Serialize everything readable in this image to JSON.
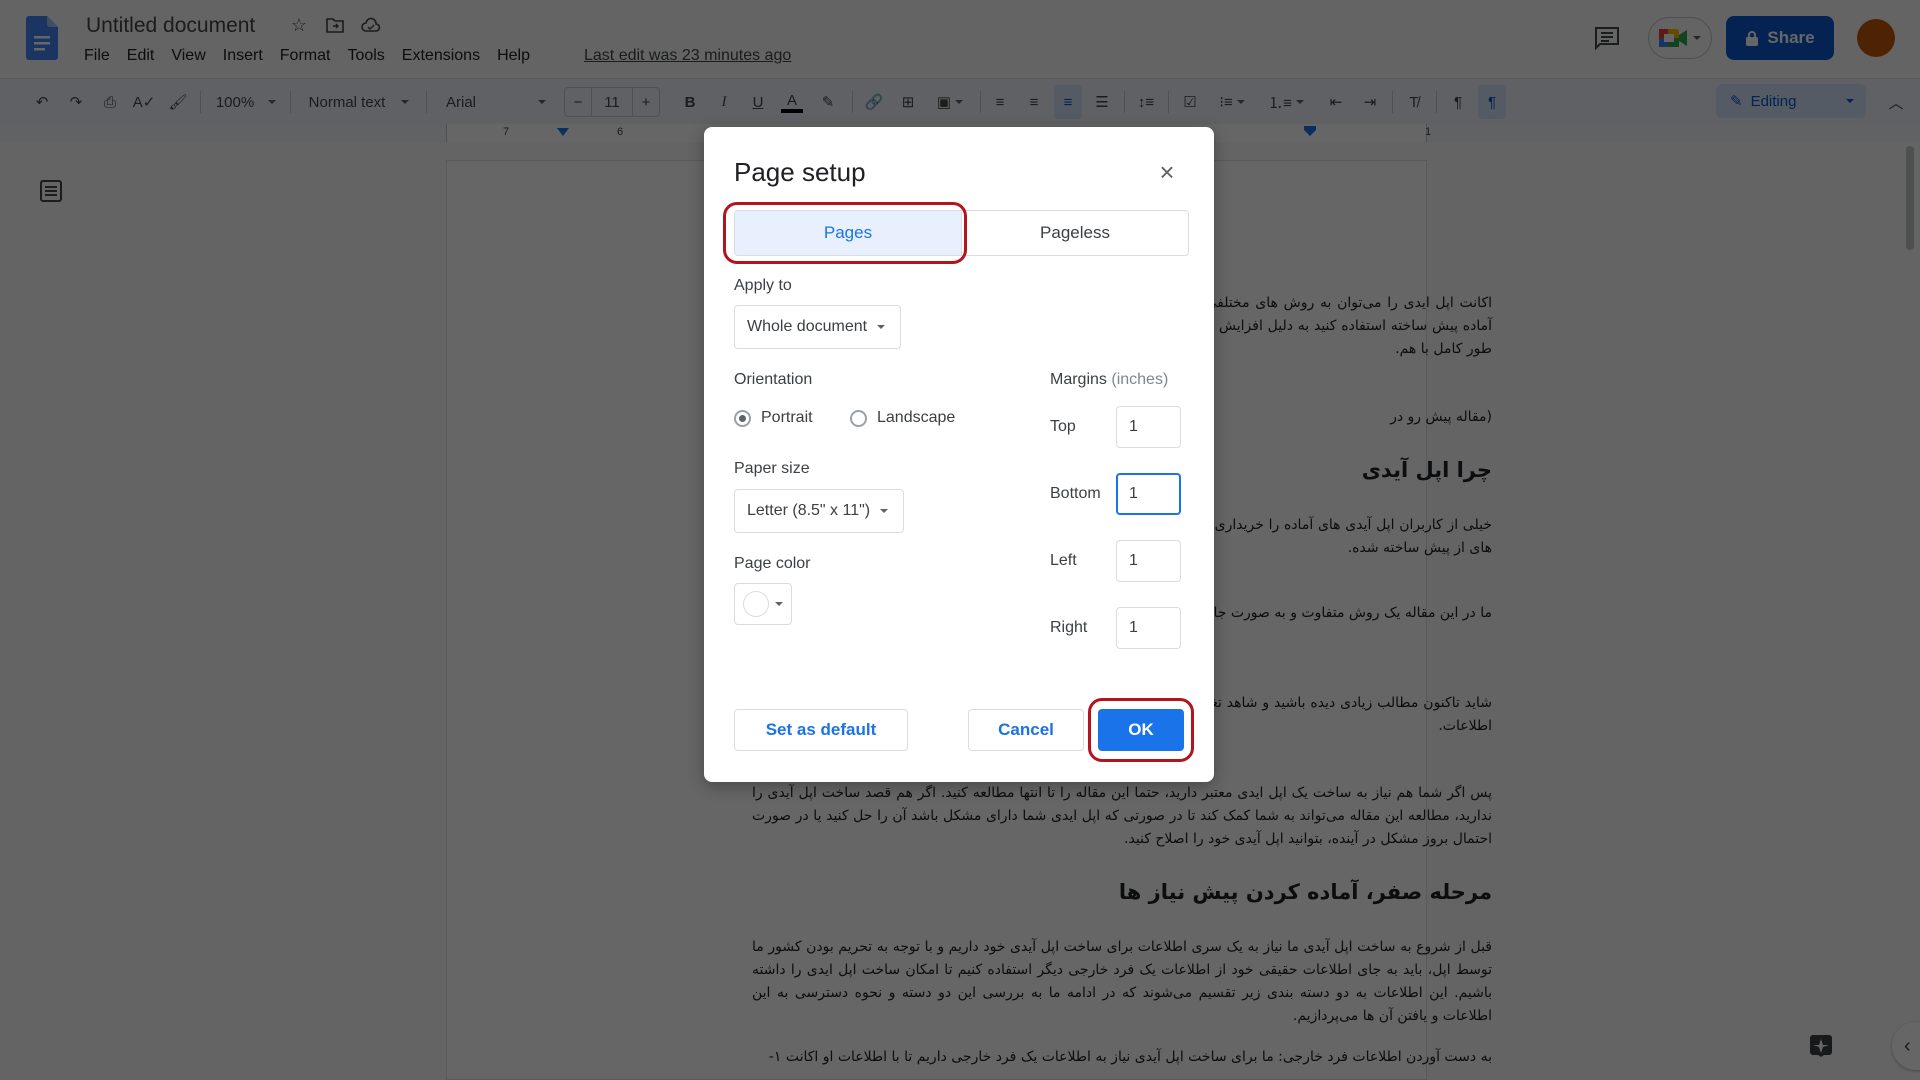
{
  "app": {
    "title": "Untitled document",
    "menu": [
      "File",
      "Edit",
      "View",
      "Insert",
      "Format",
      "Tools",
      "Extensions",
      "Help"
    ],
    "last_edit": "Last edit was 23 minutes ago",
    "share_label": "Share",
    "accent": "#0b57d0",
    "avatar_color": "#c2580a"
  },
  "toolbar": {
    "zoom": "100%",
    "style": "Normal text",
    "font": "Arial",
    "font_size": "11",
    "mode": "Editing",
    "ruler_labels": [
      "7",
      "6",
      "1"
    ]
  },
  "document": {
    "paragraphs": [
      "اکانت اپل ایدی را می‌توان به روش های مختلفی ساخت. در این مقاله نحوه ساخت این اکانت است. چرا که از اپل آیدی های آماده پیش ساخته استفاده کنید به دلیل افزایش تحریم ها علیه ایران بیشتر کاربران ایرانی ممکن است مشکلات امنیتی اپل را به طور کامل با هم.",
      "(مقاله پیش رو در",
      "خیلی از کاربران اپل آیدی های آماده را خریداری میکنند که اصلا توصیه نمی‌شود. مخاطراتی مانند قطع دسترسی اپل به اپل آیدی های از پیش ساخته شده.",
      "ما در این مقاله یک روش متفاوت و به صورت جامع برای ساخت با شماره تلفن مجازی اکانت اپل ایدی.",
      "شاید تاکنون مطالب زیادی دیده باشید و شاهد تغییر جزئی و گاها تغییر کلی در نحوه ساخت بودید. ما تست کردیم و سعی کردیم اطلاعات.",
      "پس اگر شما هم نیاز به ساخت یک اپل ایدی معتبر دارید، حتما این مقاله را تا انتها مطالعه کنید. اگر هم قصد ساخت اپل آیدی را ندارید، مطالعه این مقاله می‌تواند به شما کمک کند تا در صورتی که اپل ایدی شما دارای مشکل باشد آن را حل کنید یا در صورت احتمال بروز مشکل در آینده، بتوانید اپل آیدی خود را اصلاح کنید.",
      "قبل از شروع به ساخت اپل آیدی ما نیاز به یک سری اطلاعات برای ساخت اپل آیدی خود داریم و با توجه به تحریم بودن کشور ما توسط اپل، باید به جای اطلاعات حقیقی خود از اطلاعات یک فرد خارجی دیگر استفاده کنیم تا امکان ساخت اپل ایدی را داشته باشیم. این اطلاعات به دو دسته بندی زیر تقسیم می‌شوند که در ادامه ما به بررسی این دو دسته و نحوه دسترسی به این اطلاعات و یافتن آن ها می‌پردازیم.",
      "به دست آوردن اطلاعات فرد خارجی: ما برای ساخت اپل آیدی نیاز به اطلاعات یک فرد خارجی داریم تا با اطلاعات او اکانت ۱-"
    ],
    "headings": [
      "چرا اپل آیدی",
      "مرحله صفر، آماده کردن پیش نیاز ها"
    ]
  },
  "dialog": {
    "title": "Page setup",
    "tabs": [
      {
        "label": "Pages",
        "active": true
      },
      {
        "label": "Pageless",
        "active": false
      }
    ],
    "apply_to_label": "Apply to",
    "apply_to_value": "Whole document",
    "orientation_label": "Orientation",
    "orientation_options": [
      {
        "label": "Portrait",
        "checked": true
      },
      {
        "label": "Landscape",
        "checked": false
      }
    ],
    "paper_size_label": "Paper size",
    "paper_size_value": "Letter (8.5\" x 11\")",
    "page_color_label": "Page color",
    "page_color_value": "#ffffff",
    "margins_label": "Margins",
    "margins_unit": "(inches)",
    "margins": [
      {
        "label": "Top",
        "value": "1"
      },
      {
        "label": "Bottom",
        "value": "1"
      },
      {
        "label": "Left",
        "value": "1"
      },
      {
        "label": "Right",
        "value": "1"
      }
    ],
    "set_default_label": "Set as default",
    "cancel_label": "Cancel",
    "ok_label": "OK",
    "highlight_color": "#b3141d"
  }
}
